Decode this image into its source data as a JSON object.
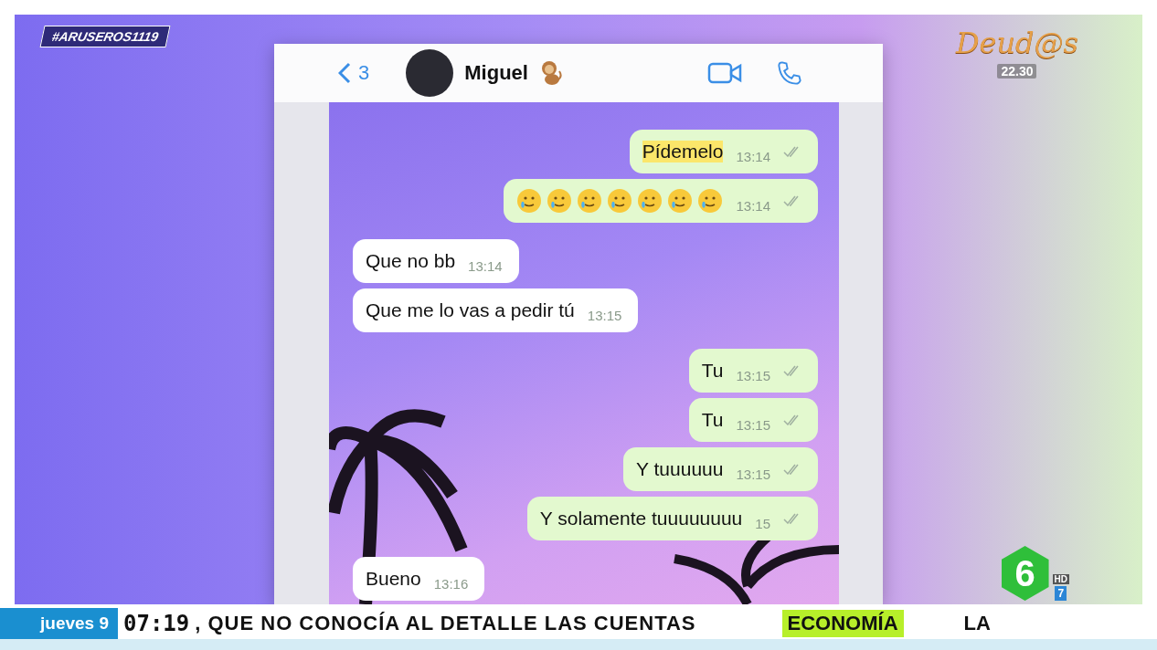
{
  "hashtag": "#ARUSEROS1119",
  "show_promo": {
    "title": "Deud@s",
    "time": "22.30"
  },
  "chat": {
    "back_count": "3",
    "contact": "Miguel",
    "messages": [
      {
        "kind": "sent",
        "text": "Pídemelo",
        "highlighted": true,
        "time": "13:14",
        "read": true
      },
      {
        "kind": "sent",
        "time": "13:14",
        "read": true
      },
      {
        "kind": "received",
        "text": "Que no bb",
        "time": "13:14"
      },
      {
        "kind": "received",
        "text": "Que me lo vas a pedir tú",
        "time": "13:15"
      },
      {
        "kind": "sent",
        "text": "Tu",
        "time": "13:15",
        "read": true
      },
      {
        "kind": "sent",
        "text": "Tu",
        "time": "13:15",
        "read": true
      },
      {
        "kind": "sent",
        "text": "Y tuuuuuu",
        "time": "13:15",
        "read": true
      },
      {
        "kind": "sent",
        "text": "Y solamente tuuuuuuuu",
        "time": "15",
        "read": true
      },
      {
        "kind": "received",
        "text": "Bueno",
        "time": "13:16"
      }
    ]
  },
  "channel_logo": {
    "number": "6",
    "quality": "HD",
    "sub_channel": "7"
  },
  "ticker": {
    "day": "jueves 9",
    "clock": "07:19",
    "headline": ", QUE NO CONOCÍA AL DETALLE LAS CUENTAS",
    "section": "ECONOMÍA",
    "next": "LA"
  }
}
